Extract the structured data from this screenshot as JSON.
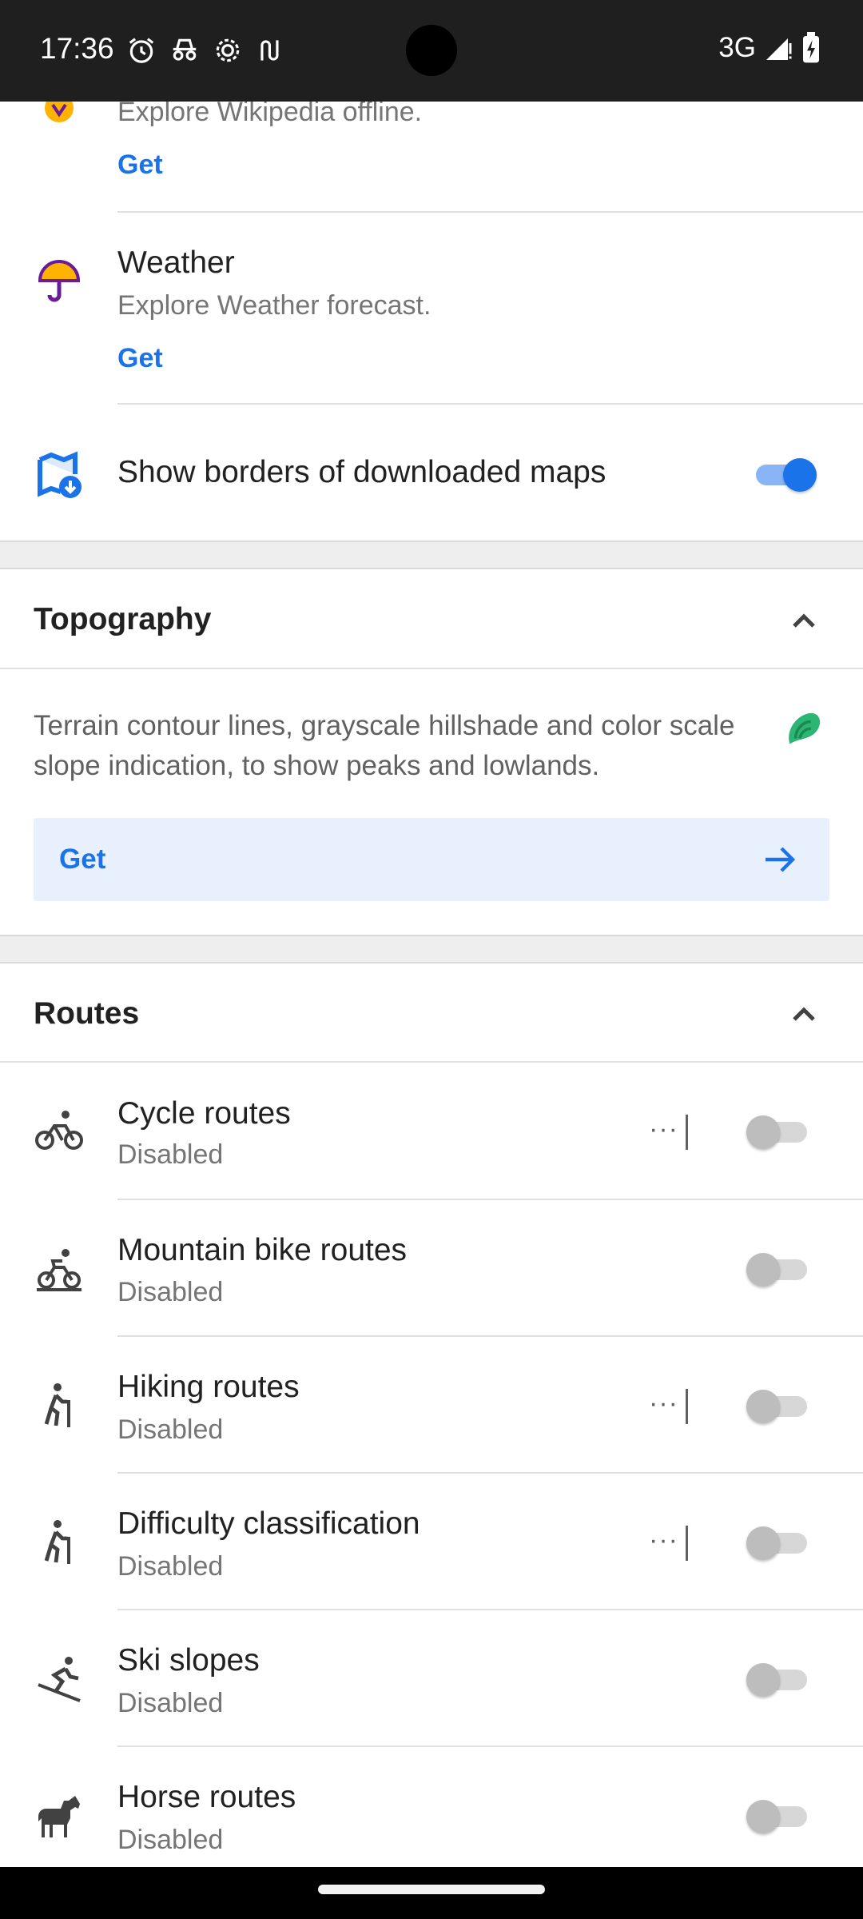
{
  "status_bar": {
    "time": "17:36",
    "network": "3G"
  },
  "wikipedia": {
    "description": "Explore Wikipedia offline.",
    "get_label": "Get"
  },
  "weather": {
    "title": "Weather",
    "description": "Explore Weather forecast.",
    "get_label": "Get"
  },
  "borders": {
    "label": "Show borders of downloaded maps",
    "enabled": true
  },
  "topography": {
    "title": "Topography",
    "description": "Terrain contour lines, grayscale hillshade and color scale slope indication, to show peaks and lowlands.",
    "get_label": "Get"
  },
  "routes": {
    "title": "Routes",
    "items": [
      {
        "icon": "bicycle-icon",
        "title": "Cycle routes",
        "status": "Disabled",
        "has_more": true,
        "enabled": false
      },
      {
        "icon": "mountain-bike-icon",
        "title": "Mountain bike routes",
        "status": "Disabled",
        "has_more": false,
        "enabled": false
      },
      {
        "icon": "hiking-icon",
        "title": "Hiking routes",
        "status": "Disabled",
        "has_more": true,
        "enabled": false
      },
      {
        "icon": "hiking-icon",
        "title": "Difficulty classification",
        "status": "Disabled",
        "has_more": true,
        "enabled": false
      },
      {
        "icon": "ski-icon",
        "title": "Ski slopes",
        "status": "Disabled",
        "has_more": false,
        "enabled": false
      },
      {
        "icon": "horse-icon",
        "title": "Horse routes",
        "status": "Disabled",
        "has_more": false,
        "enabled": false
      }
    ],
    "more_label": "···"
  },
  "colors": {
    "accent": "#1a73e8",
    "get_bar_bg": "#e8f0fd",
    "topography_icon": "#2bb673",
    "weather_icon_umbrella": "#ffb300",
    "weather_icon_purple": "#6a1b9a"
  }
}
